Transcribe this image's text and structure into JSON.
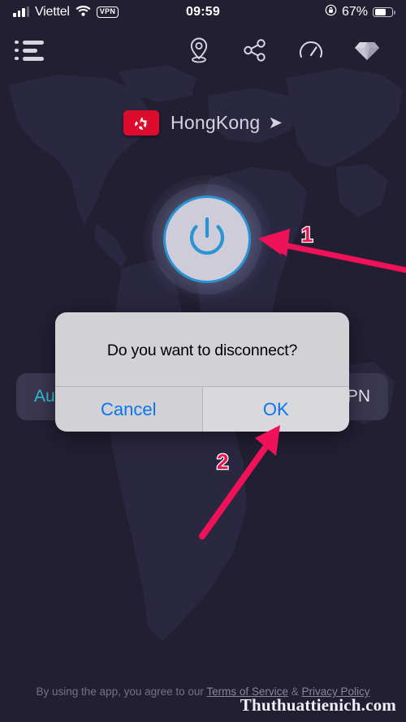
{
  "status_bar": {
    "carrier": "Viettel",
    "signal_icon": "cellular-signal-icon",
    "wifi_icon": "wifi-icon",
    "vpn_badge": "VPN",
    "time": "09:59",
    "rotation_lock_icon": "rotation-lock-icon",
    "battery_percent": "67%",
    "battery_level": 67
  },
  "top_nav": {
    "menu_icon": "list-menu-icon",
    "items": [
      {
        "icon": "location-pin-icon",
        "label": "Location"
      },
      {
        "icon": "share-icon",
        "label": "Share"
      },
      {
        "icon": "speedometer-icon",
        "label": "Speed test"
      },
      {
        "icon": "diamond-icon",
        "label": "Premium"
      }
    ]
  },
  "location": {
    "flag_icon": "hongkong-flag-icon",
    "country": "HongKong",
    "arrow": "➤"
  },
  "power": {
    "icon": "power-icon",
    "state": "connected",
    "ring_color": "#2a93d4",
    "face_color": "#cfccd9"
  },
  "connection_bar": {
    "mode": "Auto",
    "protocol": "VPN",
    "mode_color": "#30c2d8"
  },
  "alert": {
    "title": "Do you want to disconnect?",
    "cancel_label": "Cancel",
    "ok_label": "OK",
    "tint_color": "#0a75f0"
  },
  "annotations": {
    "markers": [
      {
        "label": "1",
        "target": "power-button",
        "color": "#e8184f"
      },
      {
        "label": "2",
        "target": "ok-button",
        "color": "#e8184f"
      }
    ],
    "arrow_color": "#ef1259"
  },
  "footer": {
    "text_before": "By using the app, you agree to our ",
    "terms_link": "Terms of Service",
    "separator": " & ",
    "privacy_link": "Privacy Policy"
  },
  "watermark": {
    "text": "Thuthuattienich.com"
  }
}
